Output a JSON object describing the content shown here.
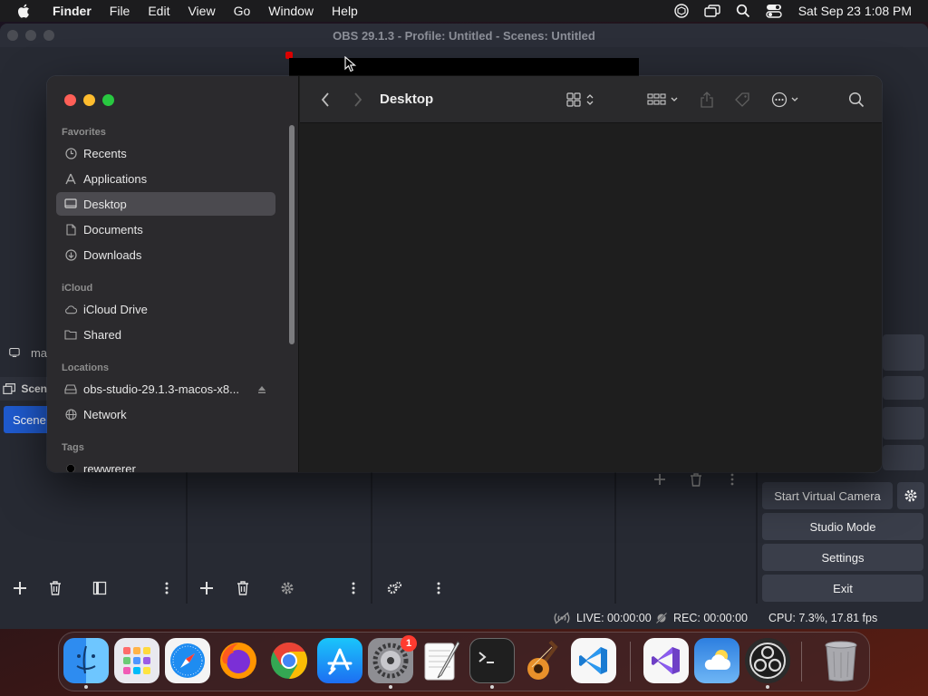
{
  "menubar": {
    "app_name": "Finder",
    "menus": [
      "File",
      "Edit",
      "View",
      "Go",
      "Window",
      "Help"
    ],
    "status_icons": [
      "openai-icon",
      "screen-mirroring-icon",
      "spotlight-search-icon",
      "control-center-icon"
    ],
    "clock": "Sat Sep 23  1:08 PM"
  },
  "obs": {
    "title": "OBS 29.1.3 - Profile: Untitled - Scenes: Untitled",
    "source_row_label": "ma",
    "scenes_header": "Scen",
    "scene_item": "Scene",
    "controls": {
      "start_virtual_camera": "Start Virtual Camera",
      "studio_mode": "Studio Mode",
      "settings": "Settings",
      "exit": "Exit"
    },
    "status": {
      "live": "LIVE: 00:00:00",
      "rec": "REC: 00:00:00",
      "cpu": "CPU: 7.3%, 17.81 fps"
    }
  },
  "finder": {
    "title": "Desktop",
    "sections": {
      "favorites": "Favorites",
      "icloud": "iCloud",
      "locations": "Locations",
      "tags": "Tags"
    },
    "favorites": [
      {
        "label": "Recents",
        "icon": "clock-icon"
      },
      {
        "label": "Applications",
        "icon": "applications-icon"
      },
      {
        "label": "Desktop",
        "icon": "desktop-icon",
        "selected": true
      },
      {
        "label": "Documents",
        "icon": "document-icon"
      },
      {
        "label": "Downloads",
        "icon": "downloads-icon"
      }
    ],
    "icloud": [
      {
        "label": "iCloud Drive",
        "icon": "cloud-icon"
      },
      {
        "label": "Shared",
        "icon": "shared-folder-icon"
      }
    ],
    "locations": [
      {
        "label": "obs-studio-29.1.3-macos-x8...",
        "icon": "disk-icon"
      },
      {
        "label": "Network",
        "icon": "globe-icon"
      }
    ],
    "tags": [
      {
        "label": "rewwrerer",
        "color": "#000000"
      }
    ]
  },
  "dock": {
    "apps": [
      {
        "name": "Finder",
        "running": true
      },
      {
        "name": "Launchpad",
        "running": false
      },
      {
        "name": "Safari",
        "running": false
      },
      {
        "name": "Firefox",
        "running": false
      },
      {
        "name": "Google Chrome",
        "running": false
      },
      {
        "name": "App Store",
        "running": false
      },
      {
        "name": "System Settings",
        "running": true,
        "badge": "1"
      },
      {
        "name": "TextEdit",
        "running": false
      },
      {
        "name": "Terminal",
        "running": true
      },
      {
        "name": "GarageBand",
        "running": false
      },
      {
        "name": "Visual Studio Code",
        "running": false
      },
      {
        "name": "Visual Studio",
        "running": false
      },
      {
        "name": "Weather",
        "running": false
      },
      {
        "name": "OBS Studio",
        "running": true
      },
      {
        "name": "Trash",
        "running": false
      }
    ]
  },
  "colors": {
    "accent_blue": "#1f5bd0",
    "finder_selected": "#4b4a4f",
    "red": "#ff5f57",
    "yellow": "#febc2e",
    "green": "#28c840"
  }
}
